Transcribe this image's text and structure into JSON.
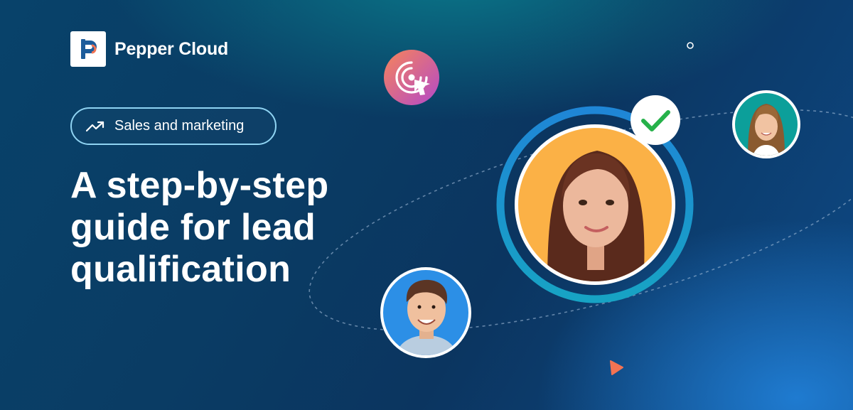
{
  "brand": {
    "name": "Pepper Cloud"
  },
  "tag": {
    "label": "Sales and marketing",
    "icon": "trending-up-icon"
  },
  "headline": {
    "lines": [
      "A step-by-step",
      "guide for lead",
      "qualification"
    ]
  },
  "colors": {
    "accent_orange": "#f27353",
    "ring_blue": "#1f86d6",
    "check_green": "#26b14a",
    "tag_border": "#8fd3f2"
  },
  "illustration": {
    "icons": [
      "target-click-icon",
      "checkmark-icon",
      "play-icon",
      "small-circle-icon"
    ],
    "people": [
      "featured-lead-avatar",
      "man-avatar",
      "woman-avatar-small"
    ]
  }
}
